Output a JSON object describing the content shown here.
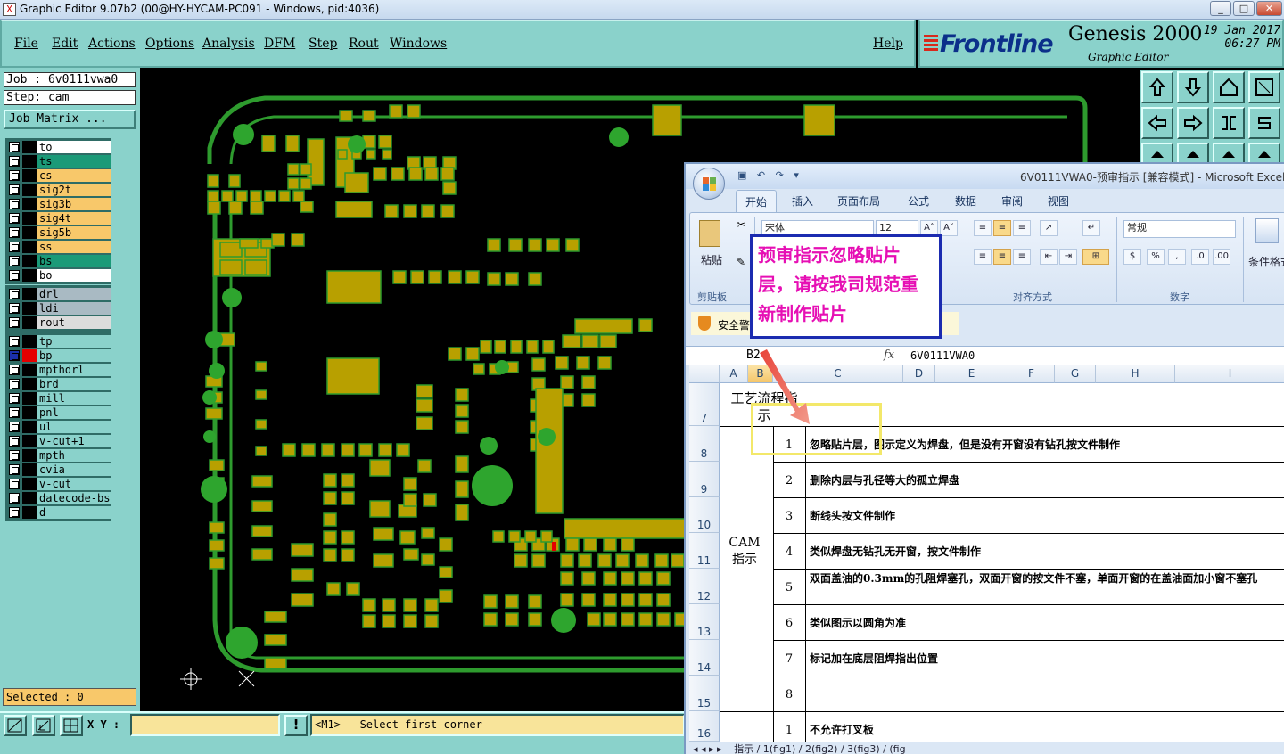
{
  "window": {
    "title": "Graphic Editor 9.07b2 (00@HY-HYCAM-PC091 - Windows, pid:4036)",
    "icon": "x-icon"
  },
  "menu": [
    "File",
    "Edit",
    "Actions",
    "Options",
    "Analysis",
    "DFM",
    "Step",
    "Rout",
    "Windows"
  ],
  "help_label": "Help",
  "brand": {
    "logo": "Frontline",
    "product": "Genesis 2000",
    "subtitle": "Graphic Editor",
    "date": "19 Jan 2017",
    "time": "06:27 PM",
    "logo_color": "#0b2f8a",
    "logo_stripe_color": "#d8281c"
  },
  "job": {
    "job_line": "Job : 6v0111vwa0",
    "step_line": "Step: cam",
    "matrix_button": "Job Matrix ..."
  },
  "layers": {
    "group1": [
      {
        "name": "to",
        "color": "#ffffff",
        "swatch": "#000000"
      },
      {
        "name": "ts",
        "color": "#1b9a78",
        "swatch": "#000000"
      },
      {
        "name": "cs",
        "color": "#f8c86a",
        "swatch": "#000000"
      },
      {
        "name": "sig2t",
        "color": "#f8c86a",
        "swatch": "#000000"
      },
      {
        "name": "sig3b",
        "color": "#f8c86a",
        "swatch": "#000000"
      },
      {
        "name": "sig4t",
        "color": "#f8c86a",
        "swatch": "#000000"
      },
      {
        "name": "sig5b",
        "color": "#f8c86a",
        "swatch": "#000000"
      },
      {
        "name": "ss",
        "color": "#f8c86a",
        "swatch": "#000000"
      },
      {
        "name": "bs",
        "color": "#1b9a78",
        "swatch": "#000000"
      },
      {
        "name": "bo",
        "color": "#ffffff",
        "swatch": "#000000"
      }
    ],
    "group2": [
      {
        "name": "drl",
        "color": "#a9bac3",
        "swatch": "#000000"
      },
      {
        "name": "ldi",
        "color": "#a9bac3",
        "swatch": "#000000"
      },
      {
        "name": "rout",
        "color": "#dcdcdc",
        "swatch": "#000000"
      }
    ],
    "group3": [
      {
        "name": "tp",
        "color": "#8ad2cb",
        "swatch": "#000000"
      },
      {
        "name": "bp",
        "color": "#8ad2cb",
        "swatch": "#e40000",
        "checked": true
      },
      {
        "name": "mpthdrl",
        "color": "#8ad2cb",
        "swatch": "#000000"
      },
      {
        "name": "brd",
        "color": "#8ad2cb",
        "swatch": "#000000"
      },
      {
        "name": "mill",
        "color": "#8ad2cb",
        "swatch": "#000000"
      },
      {
        "name": "pnl",
        "color": "#8ad2cb",
        "swatch": "#000000"
      },
      {
        "name": "ul",
        "color": "#8ad2cb",
        "swatch": "#000000"
      },
      {
        "name": "v-cut+1",
        "color": "#8ad2cb",
        "swatch": "#000000"
      },
      {
        "name": "mpth",
        "color": "#8ad2cb",
        "swatch": "#000000"
      },
      {
        "name": "cvia",
        "color": "#8ad2cb",
        "swatch": "#000000"
      },
      {
        "name": "v-cut",
        "color": "#8ad2cb",
        "swatch": "#000000"
      },
      {
        "name": "datecode-bs",
        "color": "#8ad2cb",
        "swatch": "#000000"
      },
      {
        "name": "d",
        "color": "#8ad2cb",
        "swatch": "#000000"
      }
    ]
  },
  "status": {
    "selected": "Selected : 0",
    "xy_label": "X Y :",
    "xy_value": "",
    "prompt": "<M1> - Select first corner"
  },
  "excel": {
    "title": "6V0111VWA0-预审指示 [兼容模式] - Microsoft Excel",
    "tabs": [
      "开始",
      "插入",
      "页面布局",
      "公式",
      "数据",
      "审阅",
      "视图"
    ],
    "ribbon": {
      "paste": "粘贴",
      "clipboard": "剪贴板",
      "align_group": "对齐方式",
      "number_format": "常规",
      "number_group": "数字",
      "conditional": "条件格式",
      "font_name": "宋体",
      "font_size": "12"
    },
    "security": "安全警告",
    "name_box": "B2",
    "formula_value": "6V0111VWA0",
    "columns": [
      "A",
      "B",
      "C",
      "D",
      "E",
      "F",
      "G",
      "H",
      "I"
    ],
    "rows": [
      "7",
      "8",
      "9",
      "10",
      "11",
      "12",
      "13",
      "14",
      "15",
      "16"
    ],
    "header_cell": "工艺流程指示",
    "section_label": "CAM指示",
    "items": [
      {
        "num": "1",
        "text": "忽略贴片层，图示定义为焊盘，但是没有开窗没有钻孔按文件制作"
      },
      {
        "num": "2",
        "text": "删除内层与孔径等大的孤立焊盘"
      },
      {
        "num": "3",
        "text": "断线头按文件制作"
      },
      {
        "num": "4",
        "text": "类似焊盘无钻孔无开窗，按文件制作"
      },
      {
        "num": "5",
        "text": "双面盖油的0.3mm的孔阻焊塞孔，双面开窗的按文件不塞，单面开窗的在盖油面加小窗不塞孔"
      },
      {
        "num": "6",
        "text": "类似图示以圆角为准"
      },
      {
        "num": "7",
        "text": "标记加在底层阻焊指出位置"
      },
      {
        "num": "8",
        "text": ""
      },
      {
        "num": "1",
        "text": "不允许打叉板"
      }
    ],
    "sheet_tabs": "指示 / 1(fig1) / 2(fig2) / 3(fig3) / (fig"
  },
  "callout": {
    "text": "预审指示忽略贴片层，请按我司规范重新制作贴片",
    "color": "#e60fb4"
  },
  "colors": {
    "panel": "#8ad2cb",
    "pcb_pad": "#b8a000",
    "pcb_outline": "#2e9b2e"
  }
}
